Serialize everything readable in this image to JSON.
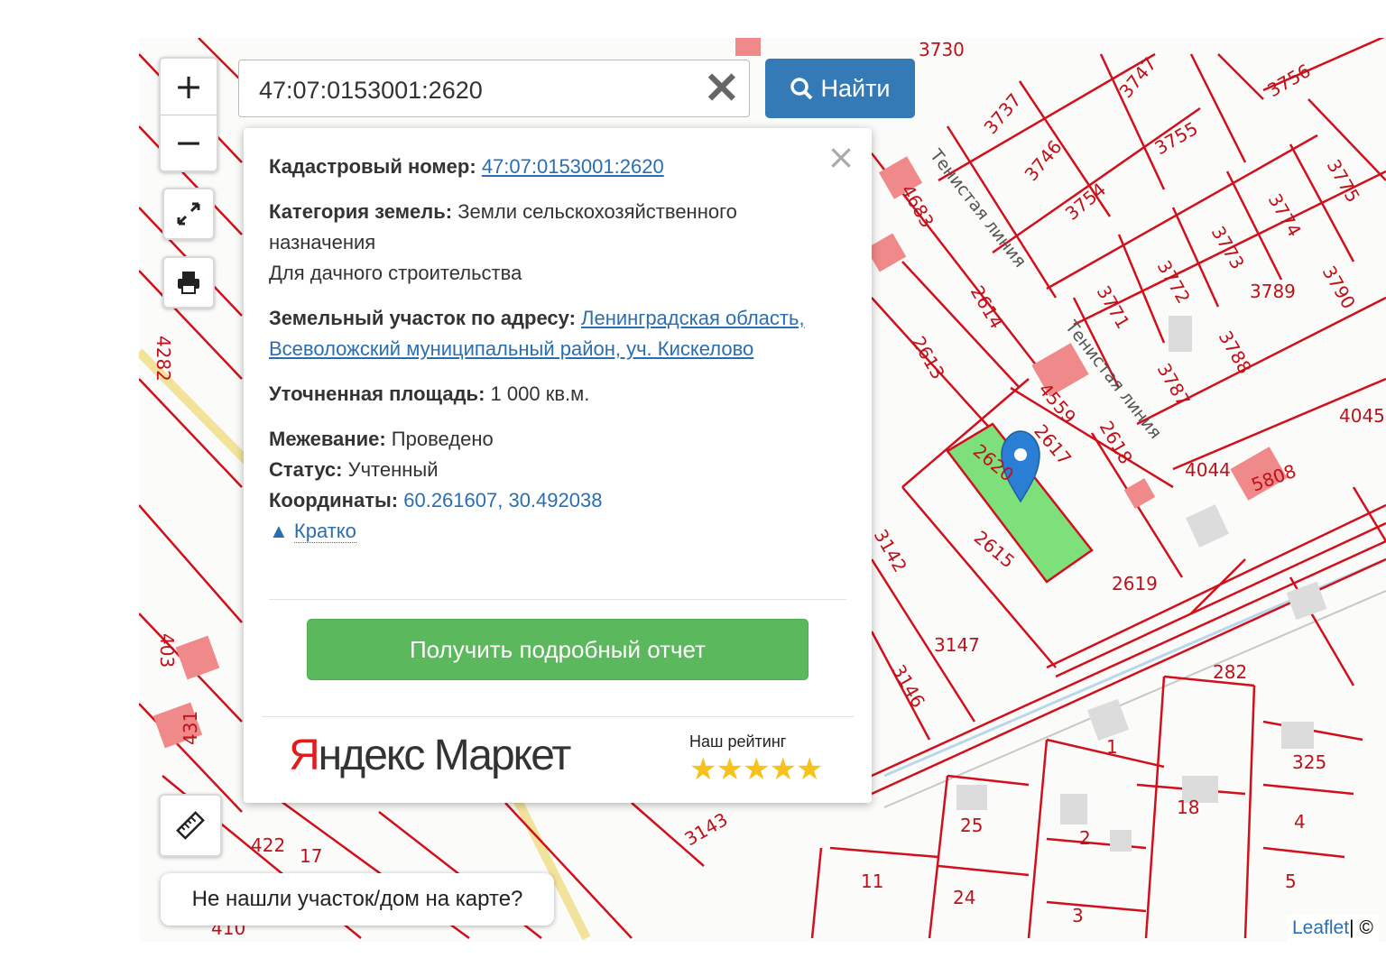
{
  "search": {
    "value": "47:07:0153001:2620",
    "button": "Найти"
  },
  "zoom": {
    "in": "+",
    "out": "−"
  },
  "popup": {
    "cadastral_label": "Кадастровый номер:",
    "cadastral_value": "47:07:0153001:2620",
    "category_label": "Категория земель:",
    "category_value": "Земли сельскохозяйственного назначения",
    "use": "Для дачного строительства",
    "address_label": "Земельный участок по адресу:",
    "address_value": "Ленинградская область, Всеволожский муниципальный район, уч. Кискелово",
    "area_label": "Уточненная площадь:",
    "area_value": "1 000 кв.м.",
    "survey_label": "Межевание:",
    "survey_value": "Проведено",
    "status_label": "Статус:",
    "status_value": "Учтенный",
    "coords_label": "Координаты:",
    "coords_value": "60.261607, 30.492038",
    "collapse": "Кратко",
    "report_button": "Получить подробный отчет",
    "brand_red": "Я",
    "brand_rest": "ндекс Маркет",
    "rating_label": "Наш рейтинг",
    "stars": "★★★★★",
    "close": "×"
  },
  "not_found": "Не нашли участок/дом на карте?",
  "attribution": {
    "leaflet": "Leaflet",
    "sep": " | ©"
  },
  "map_labels": [
    "3730",
    "3747",
    "3756",
    "3755",
    "3737",
    "3746",
    "3754",
    "3775",
    "3774",
    "3773",
    "3772",
    "3771",
    "3789",
    "3790",
    "3788",
    "3787",
    "4683",
    "2614",
    "2613",
    "4559",
    "2618",
    "2617",
    "2620",
    "2615",
    "2619",
    "4044",
    "4045",
    "5808",
    "3142",
    "3147",
    "3146",
    "3143",
    "282",
    "325",
    "18",
    "25",
    "4",
    "24",
    "11",
    "2",
    "3",
    "5",
    "1",
    "4282",
    "403",
    "431",
    "422",
    "17",
    "410"
  ],
  "streets": [
    "Тенистая линия",
    "Тенистая линия"
  ],
  "colors": {
    "parcel_line": "#d0101c",
    "selected_parcel": "#7ee07a",
    "building": "#f08a8a",
    "primary": "#337ab7",
    "success": "#5cb85c"
  }
}
